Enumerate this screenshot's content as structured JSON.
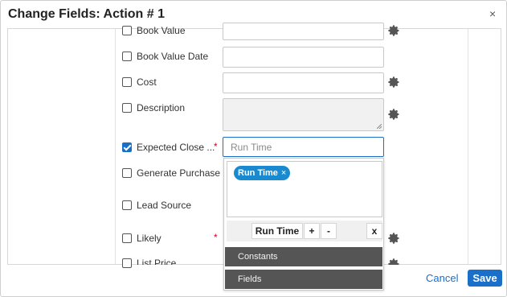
{
  "dialog": {
    "title": "Change Fields: Action # 1",
    "close_label": "×"
  },
  "rows": [
    {
      "label": "Book Value",
      "checked": false,
      "required": false
    },
    {
      "label": "Book Value Date",
      "checked": false,
      "required": false
    },
    {
      "label": "Cost",
      "checked": false,
      "required": false
    },
    {
      "label": "Description",
      "checked": false,
      "required": false
    },
    {
      "label": "Expected Close ...",
      "checked": true,
      "required": true
    },
    {
      "label": "Generate Purchase",
      "checked": false,
      "required": false
    },
    {
      "label": "Lead Source",
      "checked": false,
      "required": false
    },
    {
      "label": "Likely",
      "checked": false,
      "required": true
    },
    {
      "label": "List Price",
      "checked": false,
      "required": false
    }
  ],
  "required_mark": "*",
  "expected_close_input": {
    "placeholder": "Run Time"
  },
  "popup": {
    "chip_label": "Run Time",
    "chip_remove": "×",
    "toolbar": {
      "run_time": "Run Time",
      "plus": "+",
      "minus": "-",
      "clear": "x"
    },
    "menu": [
      "Constants",
      "Fields"
    ]
  },
  "footer": {
    "cancel_label": "Cancel",
    "save_label": "Save"
  },
  "colors": {
    "accent": "#1a6fc9",
    "chip": "#1a8ad0",
    "required": "#d0021b",
    "menu_bg": "#555555"
  },
  "icons": {
    "settings": "gear-icon",
    "close": "close-icon",
    "check": "checkmark-icon"
  }
}
